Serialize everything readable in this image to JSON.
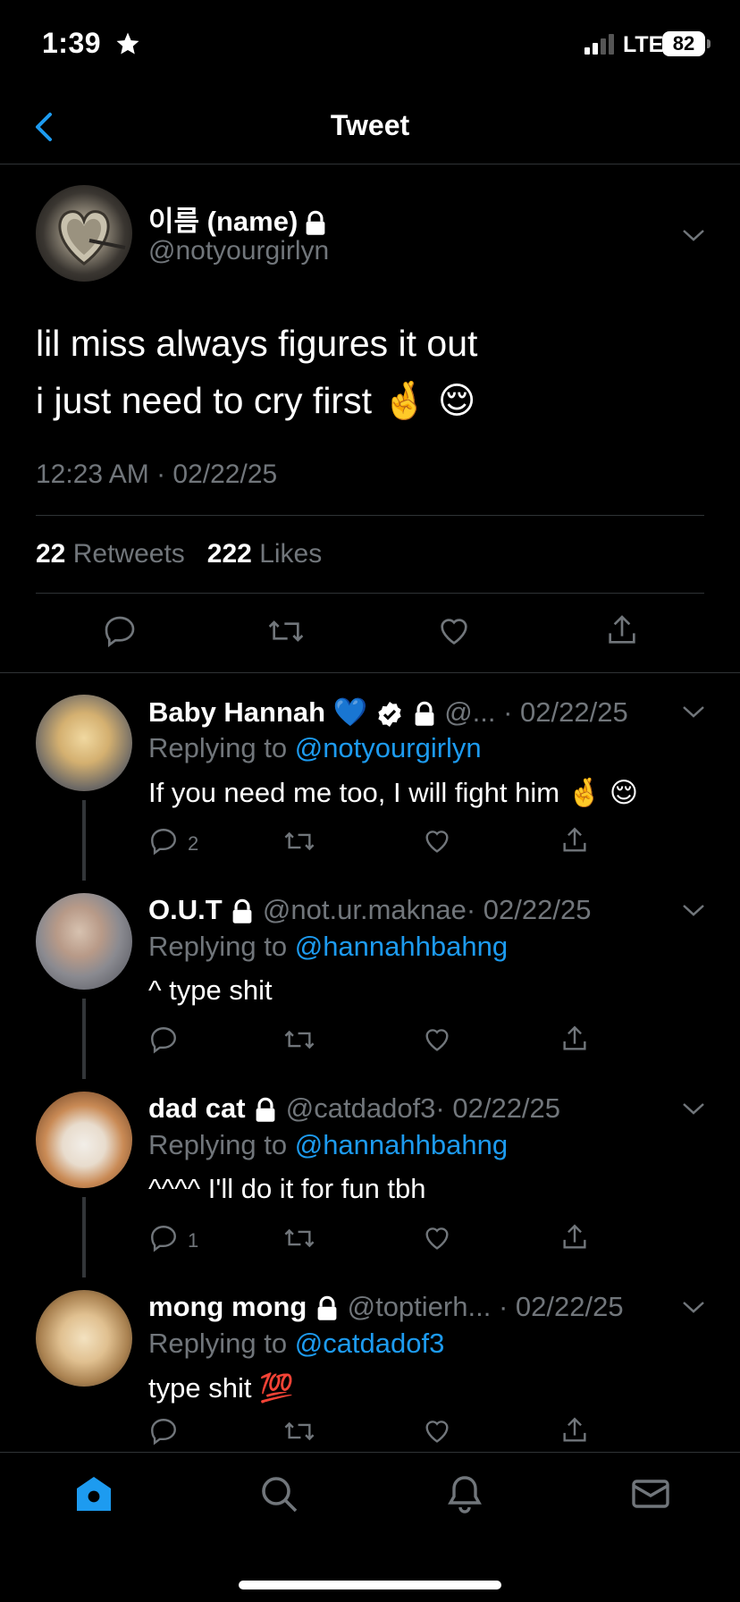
{
  "status_bar": {
    "time": "1:39",
    "network": "LTE",
    "battery": "82"
  },
  "header": {
    "title": "Tweet"
  },
  "tweet": {
    "name": "이름 (name)",
    "handle": "@notyourgirlyn",
    "text": "lil miss always figures it out\ni just need to cry first 🤞 😌",
    "timestamp": "12:23 AM · 02/22/25",
    "retweets_count": "22",
    "retweets_label": "Retweets",
    "likes_count": "222",
    "likes_label": "Likes"
  },
  "replies": [
    {
      "name": "Baby Hannah 💙",
      "handle": "@...",
      "date": "· 02/22/25",
      "replying_prefix": "Replying to",
      "replying_to": "@notyourgirlyn",
      "text": "If you need me too, I will fight him 🤞 😌",
      "reply_count": "2"
    },
    {
      "name": "O.U.T",
      "handle": "@not.ur.maknae",
      "date": "· 02/22/25",
      "replying_prefix": "Replying to",
      "replying_to": "@hannahhbahng",
      "text": "^ type shit",
      "reply_count": ""
    },
    {
      "name": "dad cat",
      "handle": "@catdadof3",
      "date": "· 02/22/25",
      "replying_prefix": "Replying to",
      "replying_to": "@hannahhbahng",
      "text": "^^^^ I'll do it for fun tbh",
      "reply_count": "1"
    },
    {
      "name": "mong mong",
      "handle": "@toptierh...",
      "date": "· 02/22/25",
      "replying_prefix": "Replying to",
      "replying_to": "@catdadof3",
      "text": "type shit 💯",
      "reply_count": ""
    }
  ],
  "colors": {
    "accent": "#1d9bf0",
    "muted": "#71767b",
    "background": "#000000"
  },
  "tabs": [
    "home-icon",
    "search-icon",
    "bell-icon",
    "mail-icon"
  ]
}
